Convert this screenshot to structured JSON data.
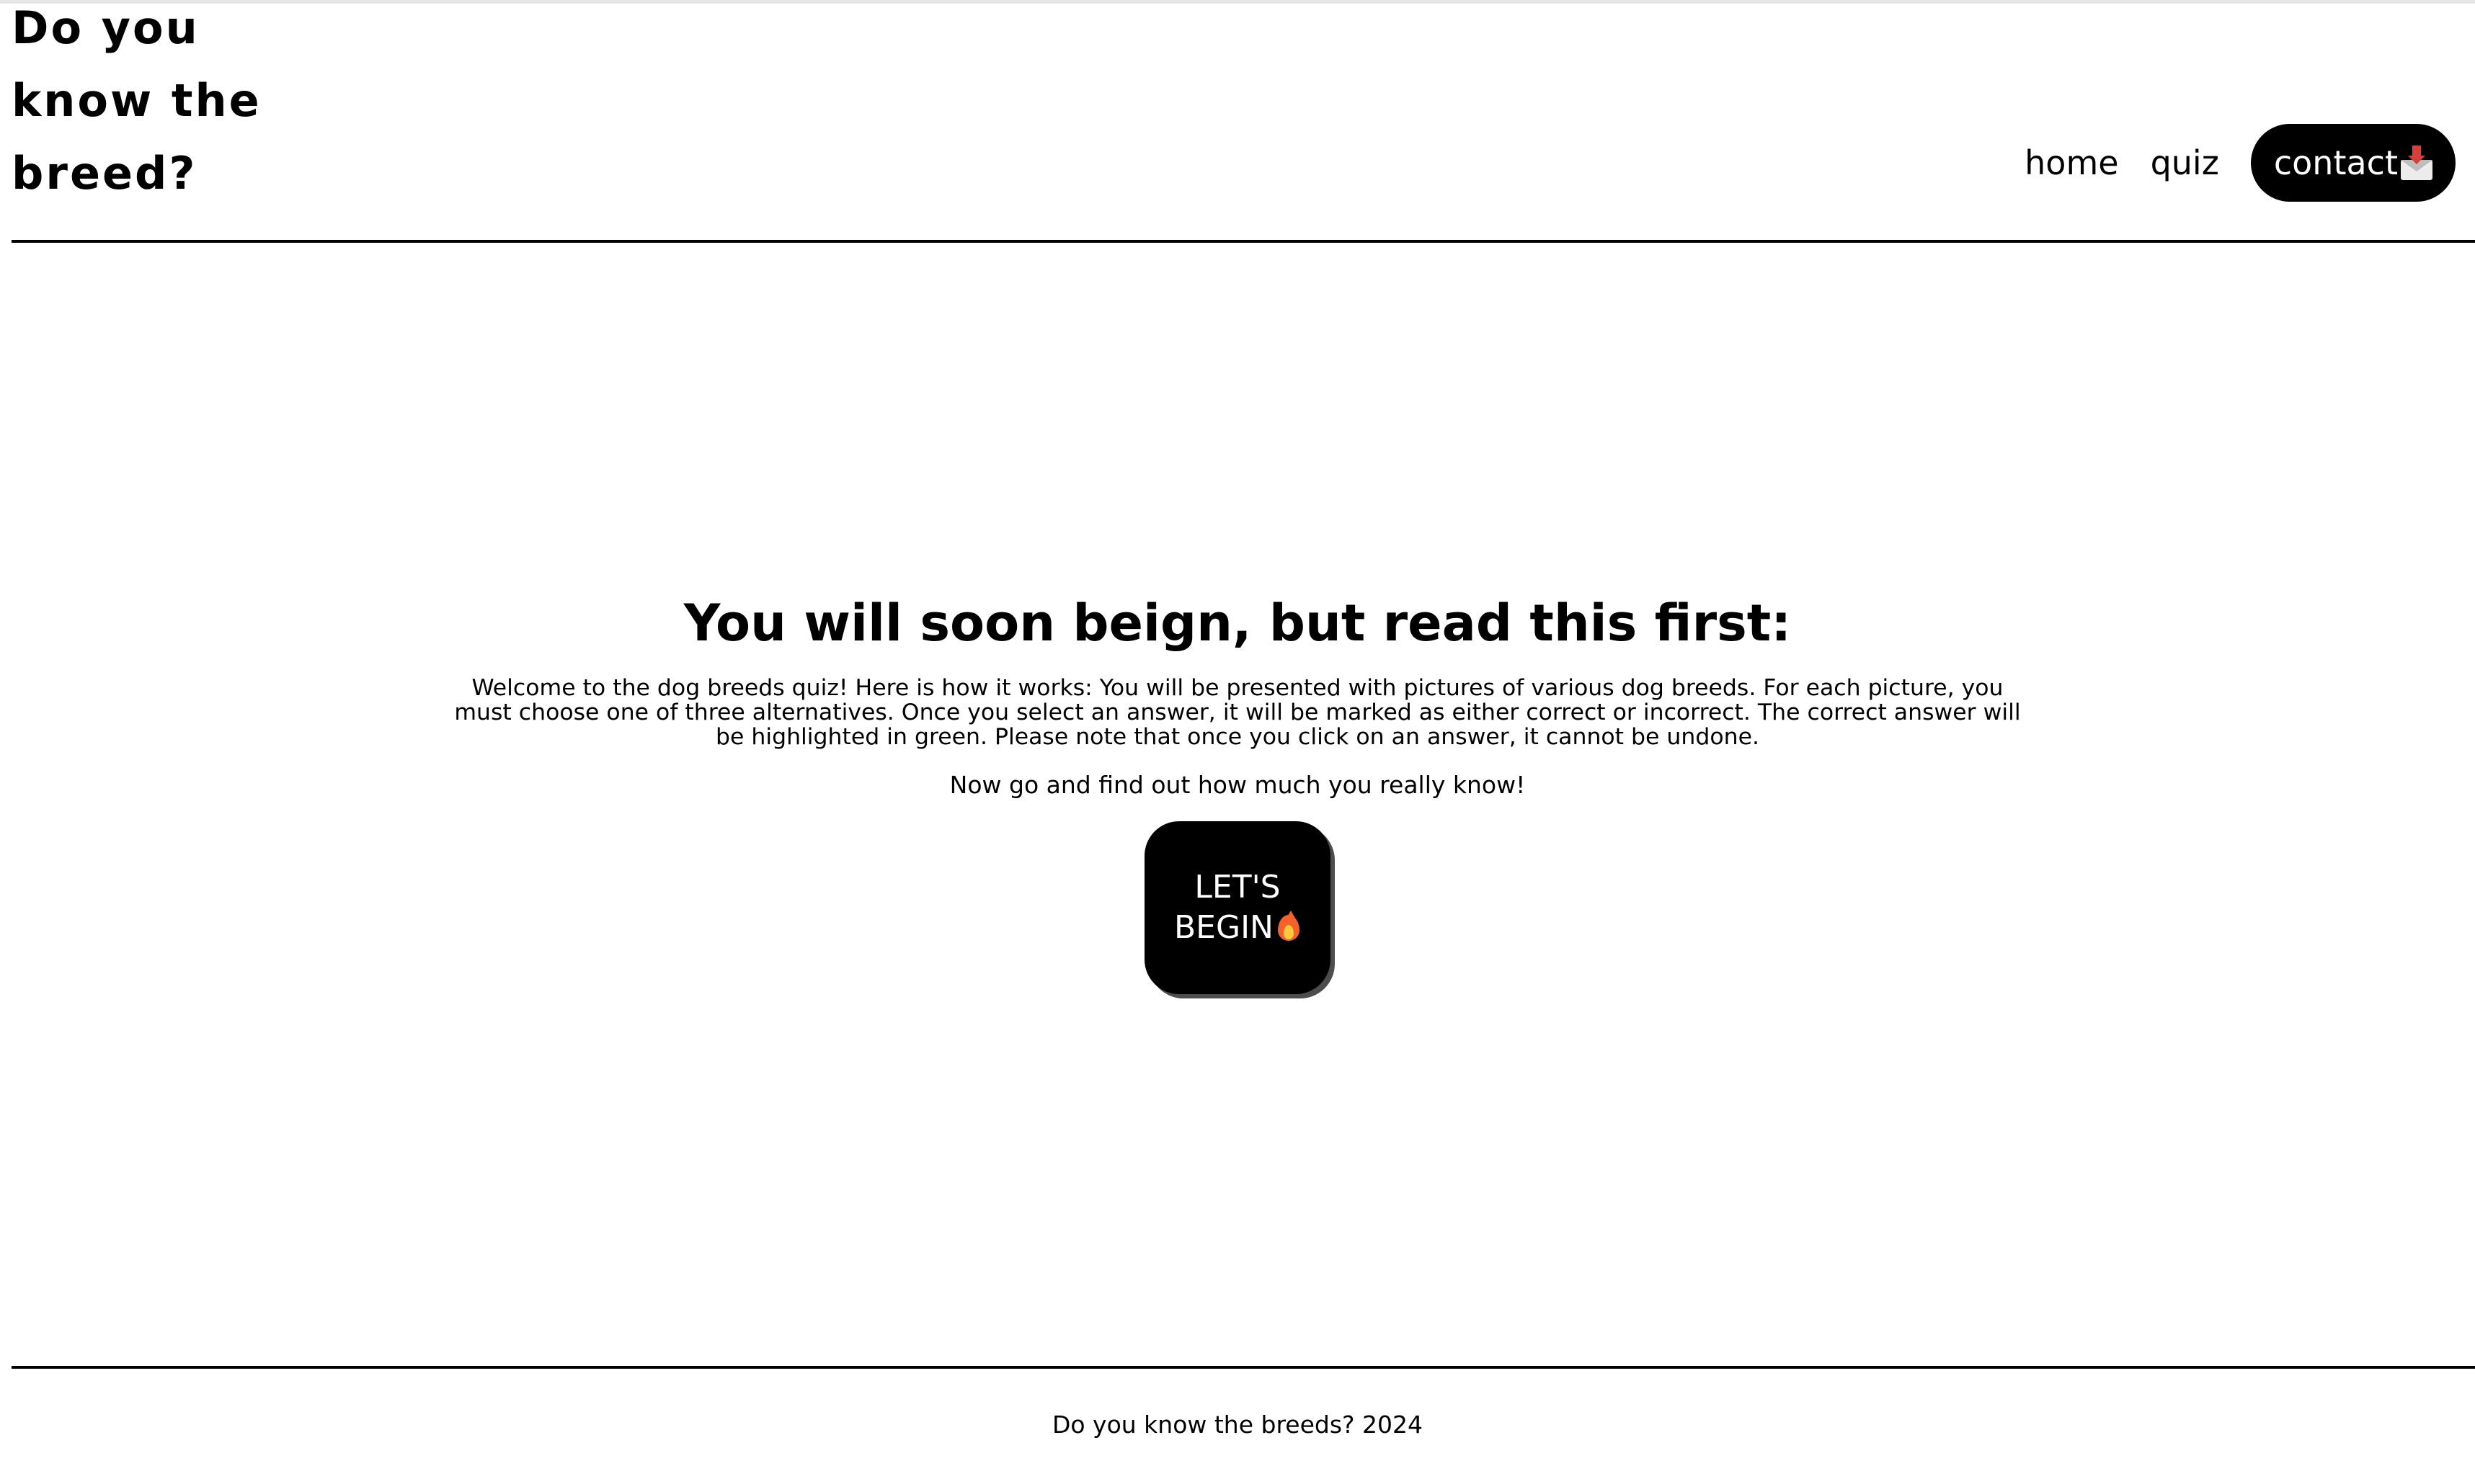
{
  "header": {
    "title_lines": [
      "Do you",
      "know the",
      "breed?"
    ],
    "nav": {
      "home_label": "home",
      "quiz_label": "quiz",
      "contact_label": "contact",
      "contact_icon": "envelope-with-arrow-icon"
    }
  },
  "main": {
    "heading": "You will soon beign, but read this first:",
    "intro": "Welcome to the dog breeds quiz! Here is how it works: You will be presented with pictures of various dog breeds. For each picture, you must choose one of three alternatives. Once you select an answer, it will be marked as either correct or incorrect. The correct answer will be highlighted in green. Please note that once you click on an answer, it cannot be undone.",
    "tagline": "Now go and find out how much you really know!",
    "begin_button": {
      "line1": "LET'S",
      "line2": "BEGIN",
      "icon": "fire-icon"
    }
  },
  "footer": {
    "text": "Do you know the breeds? 2024"
  },
  "colors": {
    "background": "#ffffff",
    "text": "#000000",
    "button_bg": "#000000",
    "button_text": "#ffffff",
    "button_shadow": "#4d4d4d"
  }
}
